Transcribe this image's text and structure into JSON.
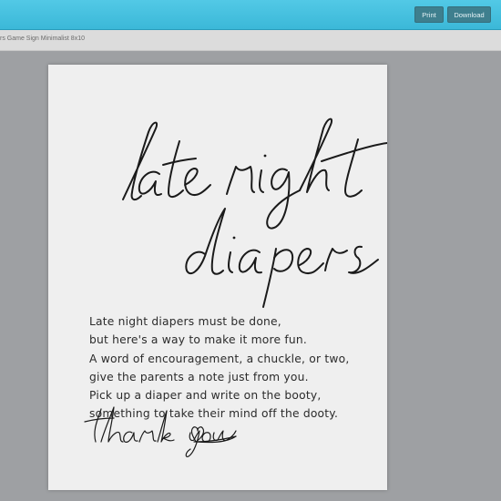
{
  "toolbar": {
    "print_label": "Print",
    "download_label": "Download"
  },
  "document": {
    "title_fragment": "rs Game Sign Minimalist 8x10"
  },
  "sign": {
    "heading_line1": "late night",
    "heading_line2": "diapers",
    "poem_lines": [
      "Late night diapers must be done,",
      "but here's a way to make it more fun.",
      "A word of encouragement, a chuckle, or two,",
      "give the parents a note just from you.",
      "Pick up a diaper and write on the booty,",
      "something to take their mind off the dooty."
    ],
    "signoff": "thank you"
  },
  "colors": {
    "topbar": "#45c0df",
    "button": "#3e7f8e",
    "workspace": "#9ea0a3",
    "page": "#efefef",
    "ink": "#1a1a1a"
  },
  "icons": {
    "heart": "heart-icon"
  }
}
